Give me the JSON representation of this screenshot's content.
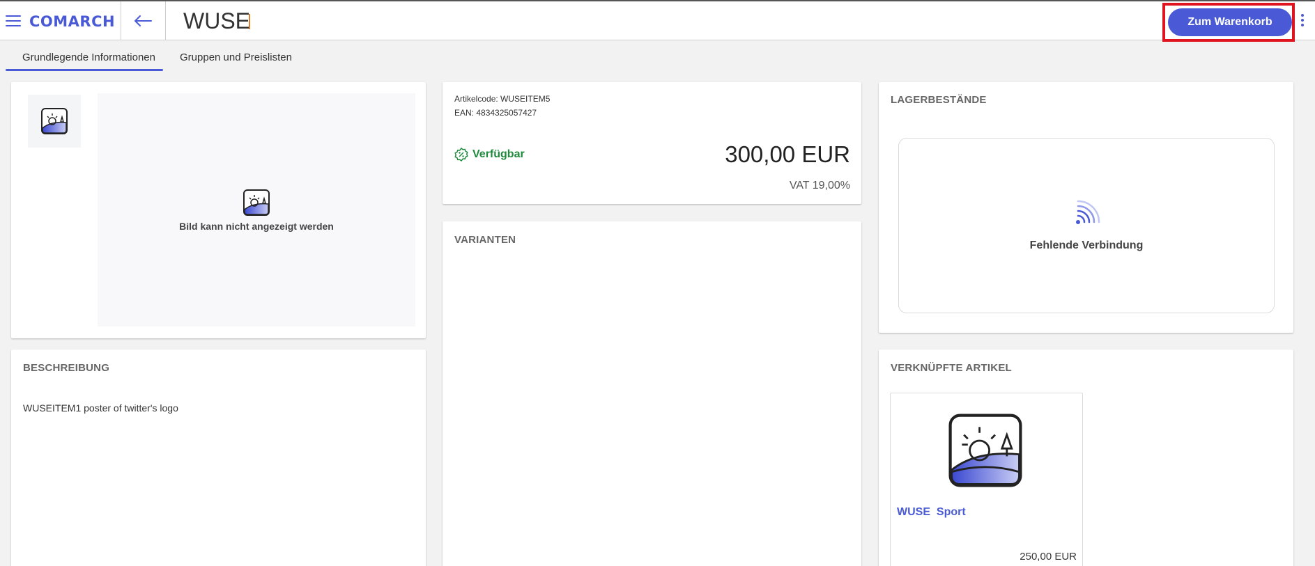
{
  "header": {
    "logo": "COMARCH",
    "title": "WUSE",
    "cart_button": "Zum Warenkorb"
  },
  "tabs": [
    {
      "label": "Grundlegende Informationen",
      "active": true
    },
    {
      "label": "Gruppen und Preislisten",
      "active": false
    }
  ],
  "gallery": {
    "placeholder_text": "Bild kann nicht angezeigt werden"
  },
  "product": {
    "code_label": "Artikelcode: WUSEITEM5",
    "ean_label": "EAN: 4834325057427",
    "availability": "Verfügbar",
    "price": "300,00 EUR",
    "vat": "VAT 19,00%"
  },
  "variants": {
    "title": "VARIANTEN"
  },
  "description": {
    "title": "BESCHREIBUNG",
    "text": "WUSEITEM1 poster of twitter's logo"
  },
  "stock": {
    "title": "LAGERBESTÄNDE",
    "message": "Fehlende Verbindung"
  },
  "related": {
    "title": "VERKNÜPFTE ARTIKEL",
    "items": [
      {
        "name": "WUSE  Sport",
        "price": "250,00 EUR"
      }
    ]
  },
  "colors": {
    "accent": "#4a5ad6",
    "available": "#1e8a3c",
    "highlight": "#e0141e"
  }
}
